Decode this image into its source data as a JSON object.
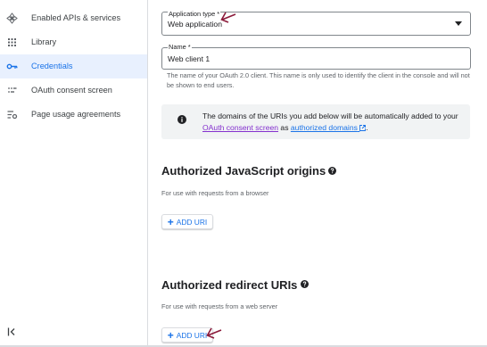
{
  "sidebar": {
    "items": [
      {
        "label": "Enabled APIs & services",
        "icon": "api-diamond-icon",
        "active": false
      },
      {
        "label": "Library",
        "icon": "library-grid-icon",
        "active": false
      },
      {
        "label": "Credentials",
        "icon": "key-icon",
        "active": true
      },
      {
        "label": "OAuth consent screen",
        "icon": "consent-dots-icon",
        "active": false
      },
      {
        "label": "Page usage agreements",
        "icon": "settings-list-icon",
        "active": false
      }
    ],
    "collapse_icon": "collapse-left-icon"
  },
  "form": {
    "app_type": {
      "label": "Application type *",
      "value": "Web application"
    },
    "name": {
      "label": "Name *",
      "value": "Web client 1"
    },
    "name_hint": "The name of your OAuth 2.0 client. This name is only used to identify the client in the console and will not be shown to end users."
  },
  "banner": {
    "text_before": "The domains of the URIs you add below will be automatically added to your ",
    "link1": "OAuth consent screen",
    "text_middle": " as ",
    "link2": "authorized domains",
    "text_after": "."
  },
  "js_origins": {
    "title": "Authorized JavaScript origins",
    "subtitle": "For use with requests from a browser",
    "add_label": "ADD URI"
  },
  "redirect_uris": {
    "title": "Authorized redirect URIs",
    "subtitle": "For use with requests from a web server",
    "add_label": "ADD URI"
  },
  "colors": {
    "accent": "#1a73e8",
    "active_bg": "#e8f0fe",
    "annotation_arrow": "#8b1a3a"
  }
}
